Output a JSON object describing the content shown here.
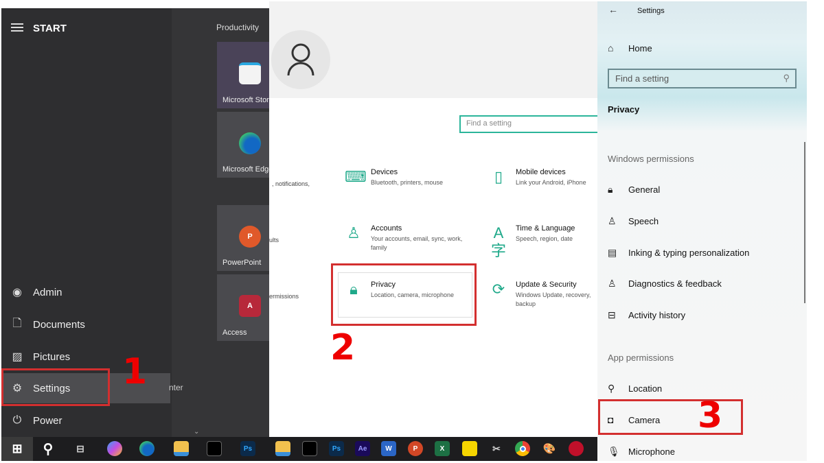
{
  "start_menu": {
    "title": "START",
    "group": "Productivity",
    "tiles": [
      {
        "label": "Microsoft Store"
      },
      {
        "label": "Microsoft Edge"
      },
      {
        "label": "PowerPoint"
      },
      {
        "label": "Access"
      }
    ],
    "items": [
      {
        "label": "Admin",
        "icon": "user-icon"
      },
      {
        "label": "Documents",
        "icon": "document-icon"
      },
      {
        "label": "Pictures",
        "icon": "picture-icon"
      },
      {
        "label": "Settings",
        "icon": "gear-icon"
      },
      {
        "label": "Power",
        "icon": "power-icon"
      }
    ],
    "partial_text": "nter"
  },
  "taskbar": {
    "icons": [
      "windows-start",
      "search",
      "task-view",
      "copilot",
      "edge",
      "file-explorer",
      "terminal",
      "photoshop",
      "file-explorer",
      "terminal",
      "photoshop",
      "after-effects",
      "word",
      "powerpoint",
      "excel",
      "sticky-notes",
      "snipping-tool",
      "chrome",
      "paint",
      "unknown-app"
    ]
  },
  "settings_home": {
    "search_placeholder": "Find a setting",
    "partial_texts": [
      ", notifications,",
      "ults",
      "ermissions"
    ],
    "categories": [
      {
        "title": "Devices",
        "desc": "Bluetooth, printers, mouse",
        "icon": "devices-icon"
      },
      {
        "title": "Mobile devices",
        "desc": "Link your Android, iPhone",
        "icon": "phone-icon"
      },
      {
        "title": "Accounts",
        "desc": "Your accounts, email, sync, work, family",
        "icon": "person-icon"
      },
      {
        "title": "Time & Language",
        "desc": "Speech, region, date",
        "icon": "time-language-icon"
      },
      {
        "title": "Privacy",
        "desc": "Location, camera, microphone",
        "icon": "lock-icon"
      },
      {
        "title": "Update & Security",
        "desc": "Windows Update, recovery, backup",
        "icon": "sync-icon"
      }
    ]
  },
  "privacy_panel": {
    "window_title": "Settings",
    "home": "Home",
    "search_placeholder": "Find a setting",
    "section": "Privacy",
    "windows_permissions": "Windows permissions",
    "win_items": [
      "General",
      "Speech",
      "Inking & typing personalization",
      "Diagnostics & feedback",
      "Activity history"
    ],
    "app_permissions": "App permissions",
    "app_items": [
      "Location",
      "Camera",
      "Microphone"
    ]
  },
  "steps": {
    "one": "1",
    "two": "2",
    "three": "3"
  },
  "colors": {
    "accent": "#1fa98a",
    "highlight": "#d32f2f"
  }
}
